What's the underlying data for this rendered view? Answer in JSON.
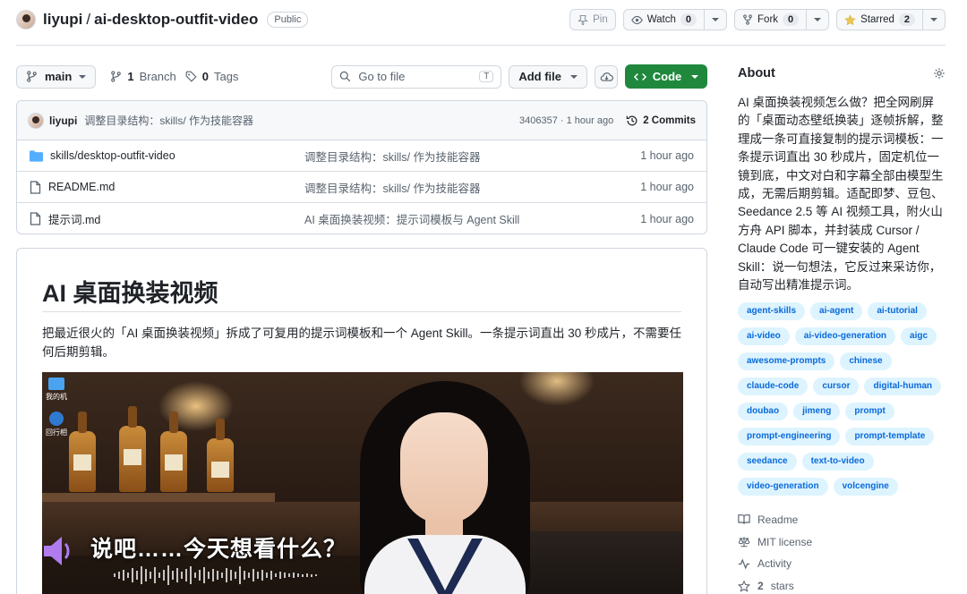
{
  "header": {
    "owner": "liyupi",
    "separator": "/",
    "repo": "ai-desktop-outfit-video",
    "visibility": "Public",
    "pin_label": "Pin",
    "watch_label": "Watch",
    "watch_count": "0",
    "fork_label": "Fork",
    "fork_count": "0",
    "star_label": "Starred",
    "star_count": "2"
  },
  "toolbar": {
    "branch": "main",
    "branch_count": "1",
    "branch_label": "Branch",
    "tag_count": "0",
    "tag_label": "Tags",
    "goto_placeholder": "Go to file",
    "goto_shortcut": "T",
    "add_file_label": "Add file",
    "code_label": "Code"
  },
  "latest_commit": {
    "author": "liyupi",
    "message": "调整目录结构：skills/ 作为技能容器",
    "sha_time": "3406357 · 1 hour ago",
    "commits_label": "2 Commits"
  },
  "files": [
    {
      "name": "skills/desktop-outfit-video",
      "type": "folder",
      "message": "调整目录结构：skills/ 作为技能容器",
      "time": "1 hour ago"
    },
    {
      "name": "README.md",
      "type": "file",
      "message": "调整目录结构：skills/ 作为技能容器",
      "time": "1 hour ago"
    },
    {
      "name": "提示词.md",
      "type": "file",
      "message": "AI 桌面换装视频：提示词模板与 Agent Skill",
      "time": "1 hour ago"
    }
  ],
  "readme": {
    "title": "AI 桌面换装视频",
    "intro": "把最近很火的「AI 桌面换装视频」拆成了可复用的提示词模板和一个 Agent Skill。一条提示词直出 30 秒成片，不需要任何后期剪辑。",
    "video_subtitle": "说吧……今天想看什么？",
    "desktop_icon_1": "我的机",
    "desktop_icon_2": "回行相"
  },
  "about": {
    "heading": "About",
    "description": "AI 桌面换装视频怎么做？把全网刷屏的「桌面动态壁纸换装」逐帧拆解，整理成一条可直接复制的提示词模板：一条提示词直出 30 秒成片，固定机位一镜到底，中文对白和字幕全部由模型生成，无需后期剪辑。适配即梦、豆包、Seedance 2.5 等 AI 视频工具，附火山方舟 API 脚本，并封装成 Cursor / Claude Code 可一键安装的 Agent Skill：说一句想法，它反过来采访你，自动写出精准提示词。",
    "topics": [
      "agent-skills",
      "ai-agent",
      "ai-tutorial",
      "ai-video",
      "ai-video-generation",
      "aigc",
      "awesome-prompts",
      "chinese",
      "claude-code",
      "cursor",
      "digital-human",
      "doubao",
      "jimeng",
      "prompt",
      "prompt-engineering",
      "prompt-template",
      "seedance",
      "text-to-video",
      "video-generation",
      "volcengine"
    ],
    "links": {
      "readme": "Readme",
      "license": "MIT license",
      "activity": "Activity",
      "stars_count": "2",
      "stars_label": "stars"
    }
  },
  "colors": {
    "accent_green": "#1f883d",
    "topic_bg": "#ddf4ff",
    "topic_text": "#0969da",
    "folder": "#54aeff"
  }
}
